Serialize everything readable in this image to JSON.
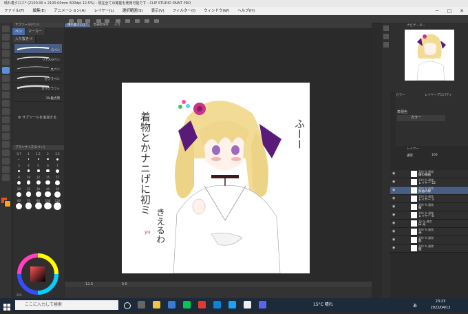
{
  "window": {
    "title": "晴れ着クロエ* (2100.00 x 2100.00mm 600dpi 12.5%) - 現在全ての機能を使用可能です - CLIP STUDIO PAINT PRO"
  },
  "menu": [
    "ファイル(F)",
    "編集(E)",
    "アニメーション(A)",
    "レイヤー(L)",
    "選択範囲(S)",
    "表示(V)",
    "フィルター(I)",
    "ウィンドウ(W)",
    "ヘルプ(H)"
  ],
  "subtool": {
    "header": "サブツール[ペン]",
    "tabs": [
      "ペン",
      "マーカー"
    ],
    "group_label": "入り抜きペ",
    "brushes": [
      "Gペン",
      "リアルGペン",
      "丸ペン",
      "カブラペン",
      "カリグラフィ",
      "3%重点用"
    ],
    "add_label": "サブツールを追加する"
  },
  "brushsize": {
    "header": "ブラシサイズ[Gペン]",
    "sizes": [
      "0.7",
      "1",
      "1.5",
      "2",
      "2.5",
      "3",
      "4",
      "5",
      "6",
      "7",
      "8",
      "10",
      "12",
      "15",
      "17",
      "20",
      "25",
      "30",
      "40",
      "50",
      "60",
      "70",
      "80",
      "100",
      "120"
    ]
  },
  "doctabs": [
    "晴れ着クロエ*",
    "普通絵保存",
    "ルカ"
  ],
  "canvas_text": {
    "line1": "着物とかナニげに初ミ",
    "line2": "きえるわ",
    "aside": "ふーー",
    "signature": "yu"
  },
  "statusbar": {
    "zoom": "12.5",
    "angle": "0.0"
  },
  "navigator": {
    "header": "ナビゲーター"
  },
  "colorpanel": {
    "header": "カラー",
    "tab2": "レイヤープロパティ",
    "effect_label": "表現色",
    "effect_value": "カラー"
  },
  "layerpanel": {
    "header": "レイヤー",
    "blend": "通常",
    "opacity": "100",
    "layers": [
      {
        "mode": "100 % 通常",
        "name": "線の線画"
      },
      {
        "mode": "100 % 通常",
        "name": "レイヤー 22"
      },
      {
        "mode": "100 % 通常",
        "name": "振袖の線"
      },
      {
        "mode": "100 % 通常",
        "name": "レイヤー 3"
      },
      {
        "mode": "100 % 通常",
        "name": "服"
      },
      {
        "mode": "100 % 通常",
        "name": "レイヤー 8"
      },
      {
        "mode": "75 % 通常",
        "name": "白 光"
      },
      {
        "mode": "100 % 通常",
        "name": "光"
      },
      {
        "mode": "100 % 通常",
        "name": "影"
      },
      {
        "mode": "100 % 通常",
        "name": "服"
      }
    ]
  },
  "colorwheel": {
    "values": [
      "255",
      "0",
      "0"
    ]
  },
  "taskbar": {
    "search_placeholder": "ここに入力して検索",
    "weather": "15°C 晴れ",
    "lang": "あ",
    "time": "23:23",
    "date": "2022/04/12"
  },
  "colors": {
    "accent": "#5f8fd8",
    "selected_layer": "#4a5e84",
    "main_color": "#e8501e",
    "sub_color": "#f5a623"
  }
}
